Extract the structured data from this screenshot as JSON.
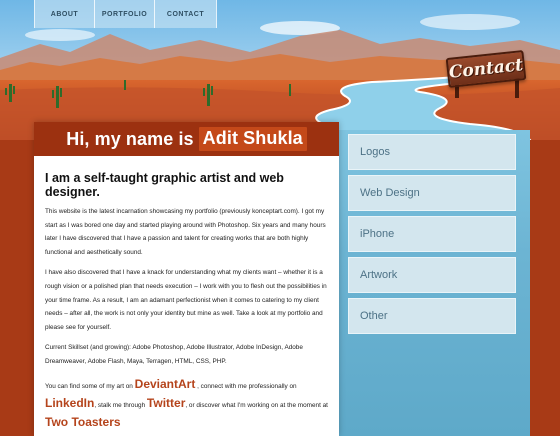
{
  "nav": {
    "items": [
      {
        "label": "ABOUT"
      },
      {
        "label": "PORTFOLIO"
      },
      {
        "label": "CONTACT"
      }
    ]
  },
  "header": {
    "sign_label": "Contact"
  },
  "main": {
    "banner_prefix": "Hi, my name is",
    "banner_name": "Adit Shukla",
    "headline": "I am a self-taught graphic artist and web designer.",
    "paragraphs": [
      "This website is the latest incarnation showcasing my portfolio (previously konceptart.com). I got my start as I was bored one day and started playing around with Photoshop. Six years and many hours later I have discovered that I have a passion and talent for creating works that are both highly functional and aesthetically sound.",
      "I have also discovered that I have a knack for understanding what my clients want – whether it is a rough vision or a polished plan that needs execution – I work with you to flesh out the possibilities in your time frame. As a result, I am an adamant perfectionist when it comes to catering to my client needs – after all, the work is not only your identity but mine as well. Take a look at my portfolio and please see for yourself.",
      "Current Skillset (and growing): Adobe Photoshop, Adobe Illustrator, Adobe InDesign, Adobe Dreamweaver, Adobe Flash, Maya, Terragen, HTML, CSS, PHP."
    ],
    "links_paragraph": {
      "text1": "You can find some of my art on",
      "link1": "DeviantArt",
      "text2": ", connect with me professionally on",
      "link2": "LinkedIn",
      "text3": ", stalk me through",
      "link3": "Twitter",
      "text4": ", or discover what I'm working on at the moment at",
      "link4": "Two Toasters"
    }
  },
  "sidebar": {
    "categories": [
      {
        "label": "Logos"
      },
      {
        "label": "Web Design"
      },
      {
        "label": "iPhone"
      },
      {
        "label": "Artwork"
      },
      {
        "label": "Other"
      }
    ]
  }
}
